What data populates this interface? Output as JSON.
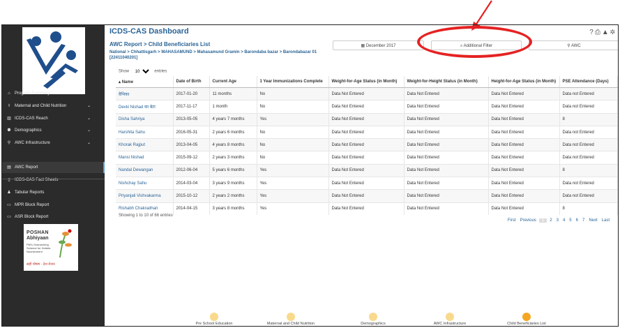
{
  "app": {
    "title": "ICDS-CAS Dashboard"
  },
  "report": {
    "title": "AWC Report > Child Beneficiaries List",
    "breadcrumb": "National > Chhattisgarh > MAHASAMUND > Mahasamund Gramin > Barondaba bazar > Barondabazar 01 [22411040201]"
  },
  "filters": {
    "date": "December 2017",
    "additional": "Additional Filter",
    "awc": "AWC"
  },
  "sidebar": {
    "items": [
      {
        "label": "Program Summary",
        "icon": "home-icon",
        "expandable": false
      },
      {
        "label": "Maternal and Child Nutrition",
        "icon": "nutrition-icon",
        "expandable": true
      },
      {
        "label": "ICDS-CAS Reach",
        "icon": "reach-chart-icon",
        "expandable": true
      },
      {
        "label": "Demographics",
        "icon": "users-icon",
        "expandable": true
      },
      {
        "label": "AWC Infrastructure",
        "icon": "location-pin-icon",
        "expandable": true
      },
      {
        "label": "AWC Report",
        "icon": "report-icon",
        "expandable": false
      },
      {
        "label": "ICDS-CAS Fact Sheets",
        "icon": "document-icon",
        "expandable": false
      },
      {
        "label": "Tabular Reports",
        "icon": "user-icon",
        "expandable": false
      },
      {
        "label": "MPR Block Report",
        "icon": "file-icon",
        "expandable": false
      },
      {
        "label": "ASR Block Report",
        "icon": "file-icon",
        "expandable": false
      }
    ],
    "poshan": {
      "line1": "POSHAN",
      "line2": "Abhiyaan",
      "tagline": "PM's Overarching Scheme for Holistic Nourishment",
      "hindi": "सही पोषण - देश रोशन"
    }
  },
  "table": {
    "show_label": "Show",
    "entries_label": "entries",
    "page_size": "10",
    "columns": [
      "Name",
      "Date of Birth",
      "Current Age",
      "1 Year Immunizations Complete",
      "Weight-for-Age Status (in Month)",
      "Weight-for-Height Status (in Month)",
      "Height-for-Age Status (in Month)",
      "PSE Attendance (Days)"
    ],
    "rows": [
      [
        "वैभिका",
        "2017-01-20",
        "11 months",
        "No",
        "Data Not Entered",
        "Data Not Entered",
        "Data Not Entered",
        "Data not Entered"
      ],
      [
        "Devki Nishad का बेटा",
        "2017-11-17",
        "1 month",
        "No",
        "Data Not Entered",
        "Data Not Entered",
        "Data Not Entered",
        "Data not Entered"
      ],
      [
        "Disha Sahriya",
        "2013-05-05",
        "4 years 7 months",
        "Yes",
        "Data Not Entered",
        "Data Not Entered",
        "Data Not Entered",
        "8"
      ],
      [
        "Harshita Sahu",
        "2016-05-31",
        "2 years 6 months",
        "No",
        "Data Not Entered",
        "Data Not Entered",
        "Data Not Entered",
        "Data not Entered"
      ],
      [
        "Khorak Rajput",
        "2013-04-05",
        "4 years 8 months",
        "No",
        "Data Not Entered",
        "Data Not Entered",
        "Data Not Entered",
        "Data not Entered"
      ],
      [
        "Mansi Nishad",
        "2015-09-12",
        "2 years 3 months",
        "No",
        "Data Not Entered",
        "Data Not Entered",
        "Data Not Entered",
        "Data not Entered"
      ],
      [
        "Nandal Dewangan",
        "2012-06-04",
        "5 years 6 months",
        "Yes",
        "Data Not Entered",
        "Data Not Entered",
        "Data Not Entered",
        "8"
      ],
      [
        "Nishchay Sahu",
        "2014-03-04",
        "3 years 9 months",
        "Yes",
        "Data Not Entered",
        "Data Not Entered",
        "Data Not Entered",
        "Data not Entered"
      ],
      [
        "Priyanjali Vishvakarma",
        "2015-10-12",
        "2 years 2 months",
        "Yes",
        "Data Not Entered",
        "Data Not Entered",
        "Data Not Entered",
        "Data not Entered"
      ],
      [
        "Rishabh Chakradhari",
        "2014-04-15",
        "3 years 8 months",
        "Yes",
        "Data Not Entered",
        "Data Not Entered",
        "Data Not Entered",
        "8"
      ]
    ],
    "showing": "Showing 1 to 10 of 66 entries"
  },
  "pagination": {
    "first": "First",
    "previous": "Previous",
    "pages": [
      "1",
      "2",
      "3",
      "4",
      "5",
      "6",
      "7"
    ],
    "current": "1",
    "next": "Next",
    "last": "Last"
  },
  "steps": [
    {
      "label": "Pre School Education",
      "active": false
    },
    {
      "label": "Maternal and Child Nutrition",
      "active": false
    },
    {
      "label": "Demographics",
      "active": false
    },
    {
      "label": "AWC Infrastructure",
      "active": false
    },
    {
      "label": "Child Beneficiaries List",
      "active": true
    }
  ],
  "colors": {
    "sidebar_bg": "#2b2b2b",
    "title_blue": "#2a6496",
    "highlight_red": "#e52222",
    "step_active": "#f5a623",
    "step_inactive": "#f9d98c"
  }
}
